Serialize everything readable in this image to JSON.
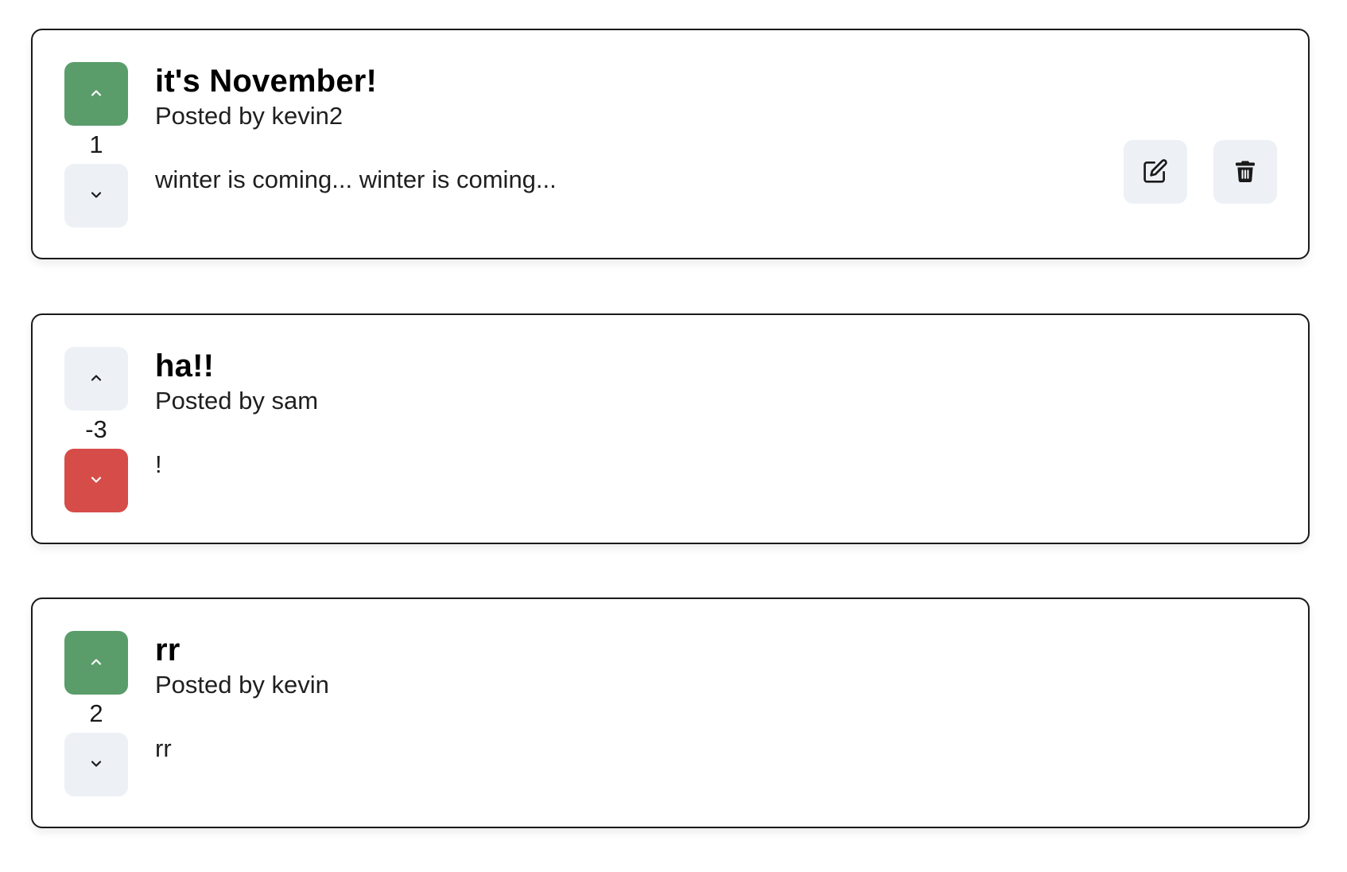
{
  "posts": [
    {
      "title": "it's November!",
      "author_line": "Posted by kevin2",
      "content": "winter is coming... winter is coming...",
      "votes": "1",
      "vote_state": "up",
      "show_actions": true
    },
    {
      "title": "ha!!",
      "author_line": "Posted by sam",
      "content": "!",
      "votes": "-3",
      "vote_state": "down",
      "show_actions": false
    },
    {
      "title": "rr",
      "author_line": "Posted by kevin",
      "content": "rr",
      "votes": "2",
      "vote_state": "up",
      "show_actions": false
    }
  ],
  "colors": {
    "upvote_active": "#5a9d6b",
    "downvote_active": "#d64c48",
    "button_neutral": "#edf1f6"
  },
  "icons": {
    "upvote": "chevron-up-icon",
    "downvote": "chevron-down-icon",
    "edit": "edit-icon",
    "delete": "trash-icon"
  }
}
